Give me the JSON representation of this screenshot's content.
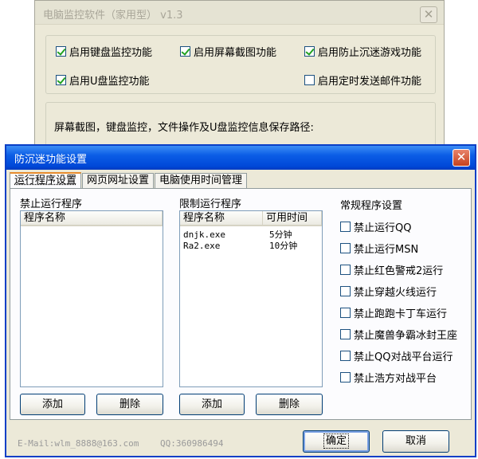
{
  "bg_window": {
    "title": "电脑监控软件（家用型） v1.3",
    "options": [
      {
        "label": "启用键盘监控功能",
        "checked": true
      },
      {
        "label": "启用屏幕截图功能",
        "checked": true
      },
      {
        "label": "启用防止沉迷游戏功能",
        "checked": true
      },
      {
        "label": "启用U盘监控功能",
        "checked": true
      },
      {
        "label": "启用定时发送邮件功能",
        "checked": false
      }
    ],
    "path_label": "屏幕截图，键盘监控，文件操作及U盘监控信息保存路径:"
  },
  "dialog": {
    "title": "防沉迷功能设置",
    "tabs": [
      "运行程序设置",
      "网页网址设置",
      "电脑使用时间管理"
    ],
    "forbid": {
      "label": "禁止运行程序",
      "col_name": "程序名称",
      "add": "添加",
      "delete": "删除"
    },
    "limit": {
      "label": "限制运行程序",
      "col_name": "程序名称",
      "col_time": "可用时间",
      "rows": [
        {
          "name": "dnjk.exe",
          "time": "5分钟"
        },
        {
          "name": "Ra2.exe",
          "time": "10分钟"
        }
      ],
      "add": "添加",
      "delete": "删除"
    },
    "common": {
      "label": "常规程序设置",
      "items": [
        {
          "label": "禁止运行QQ",
          "checked": false
        },
        {
          "label": "禁止运行MSN",
          "checked": false
        },
        {
          "label": "禁止红色警戒2运行",
          "checked": false
        },
        {
          "label": "禁止穿越火线运行",
          "checked": false
        },
        {
          "label": "禁止跑跑卡丁车运行",
          "checked": false
        },
        {
          "label": "禁止魔兽争霸冰封王座",
          "checked": false
        },
        {
          "label": "禁止QQ对战平台运行",
          "checked": false
        },
        {
          "label": "禁止浩方对战平台",
          "checked": false
        }
      ]
    },
    "footer": {
      "email": "E-Mail:wlm_8888@163.com",
      "qq": "QQ:360986494"
    },
    "ok": "确定",
    "cancel": "取消"
  },
  "colors": {
    "title_blue": "#0054e3",
    "face": "#ece9d8",
    "check_green": "#21a121",
    "close_red": "#c6411d"
  }
}
